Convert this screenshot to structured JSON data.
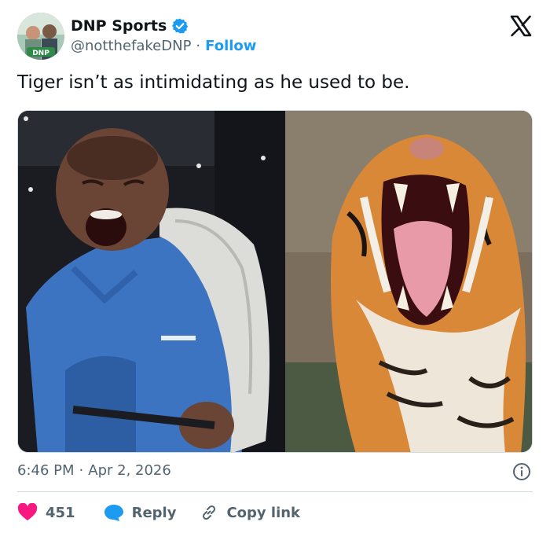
{
  "account": {
    "display_name": "DNP Sports",
    "handle": "@notthefakeDNP",
    "separator": "·",
    "follow_label": "Follow",
    "verified_color": "#1d9bf0",
    "avatar_badge": "DNP"
  },
  "tweet": {
    "text": "Tiger isn’t as intimidating as he used to be.",
    "time": "6:46 PM",
    "separator": "·",
    "date": "Apr 2, 2026"
  },
  "actions": {
    "likes": "451",
    "reply_label": "Reply",
    "copy_label": "Copy link"
  },
  "colors": {
    "accent": "#1d9bf0",
    "like": "#f91880",
    "text": "#0f1419",
    "muted": "#536471"
  },
  "icons": [
    "verified-badge-icon",
    "x-logo-icon",
    "info-icon",
    "heart-icon",
    "reply-bubble-icon",
    "link-icon"
  ]
}
